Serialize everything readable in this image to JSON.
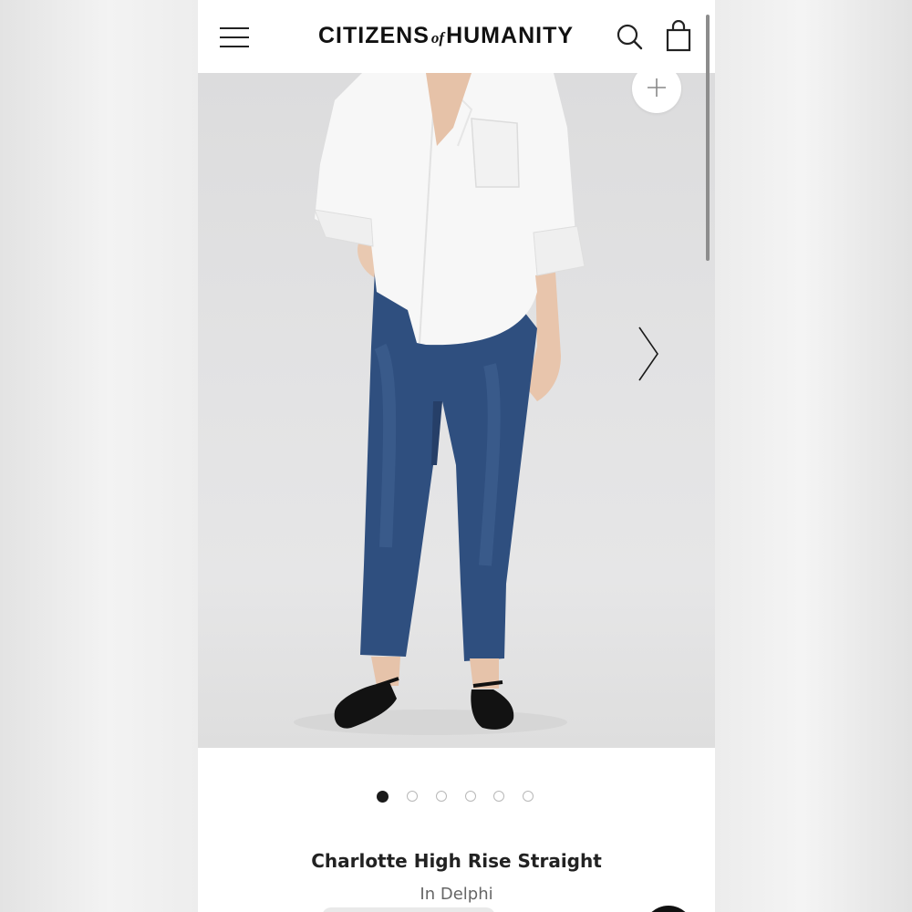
{
  "header": {
    "brand_main_1": "CITIZENS",
    "brand_of": "of",
    "brand_main_2": "HUMANITY",
    "icons": [
      "hamburger-menu-icon",
      "search-icon",
      "shopping-bag-icon"
    ]
  },
  "gallery": {
    "total_images": 6,
    "active_index": 0,
    "zoom_icon": "plus-icon",
    "next_icon": "chevron-right-icon"
  },
  "product": {
    "name": "Charlotte High Rise Straight",
    "color_line": "In Delphi"
  },
  "colors": {
    "background": "#ffffff",
    "text": "#222222",
    "muted_text": "#666666",
    "denim": "#2f4f7f"
  }
}
